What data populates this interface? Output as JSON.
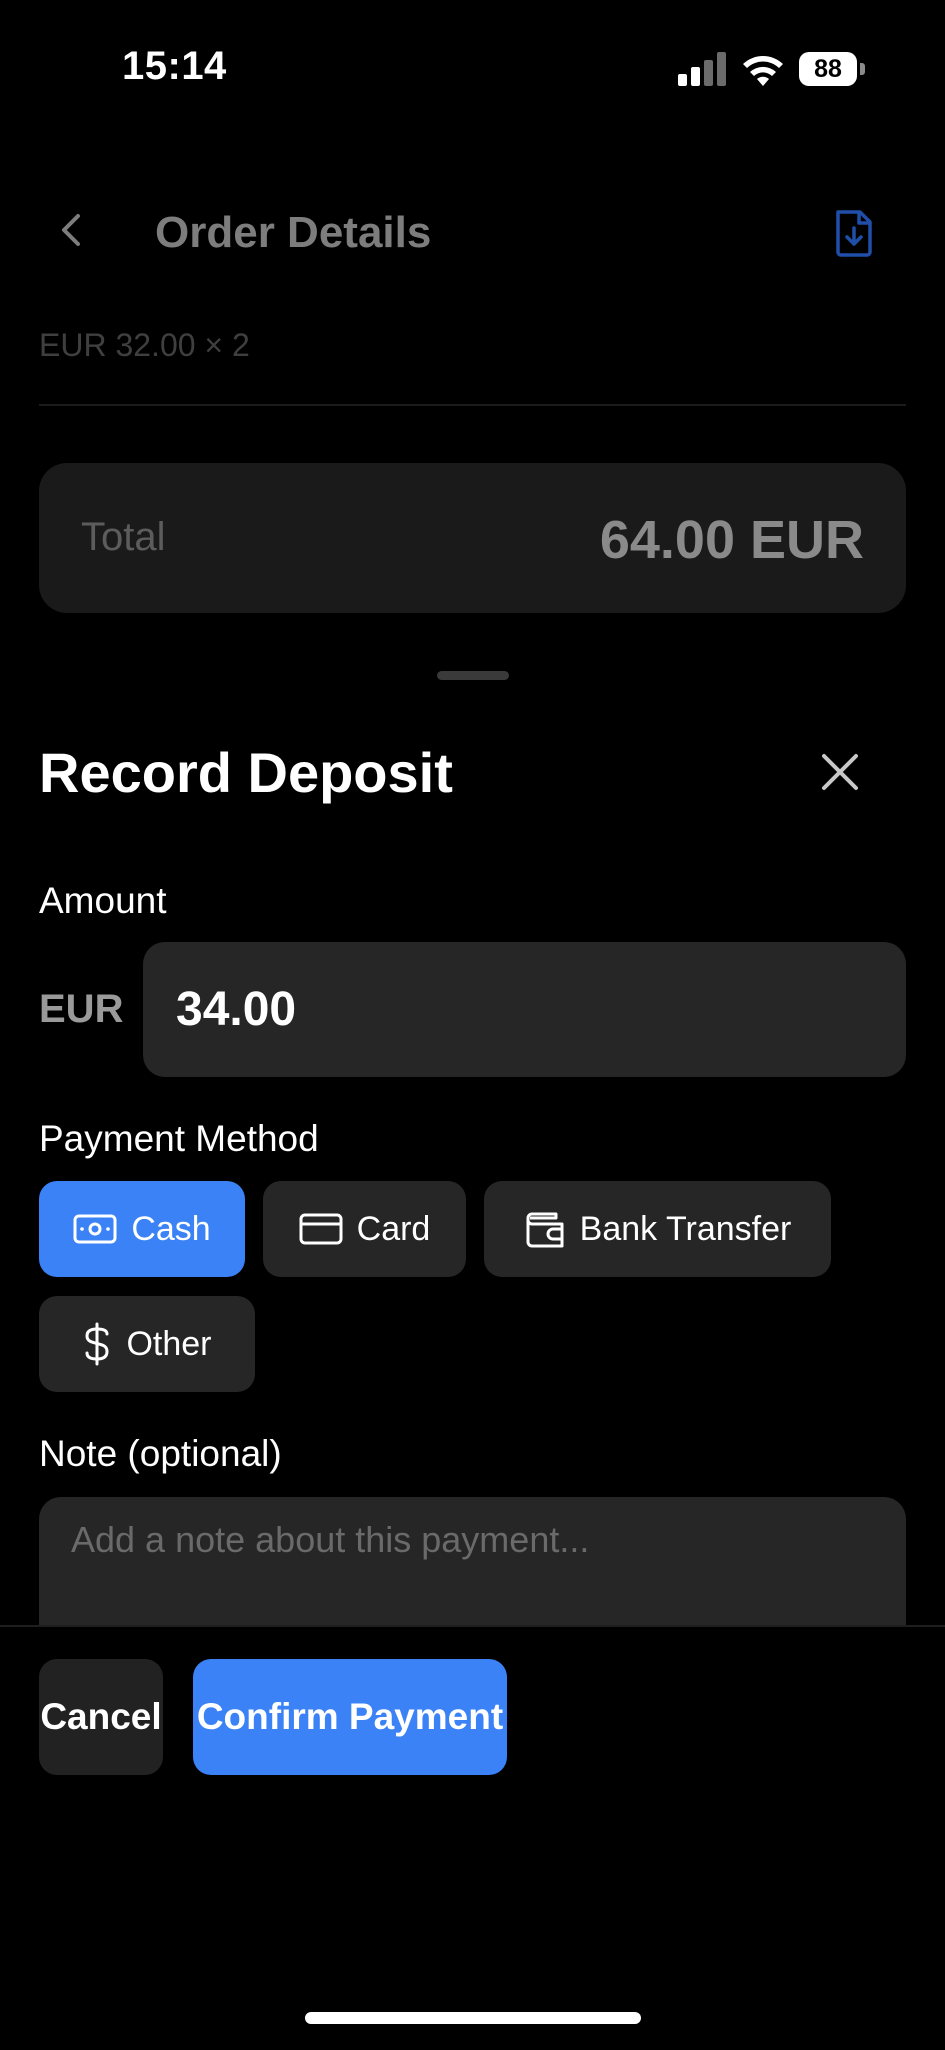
{
  "status_bar": {
    "time": "15:14",
    "battery": "88"
  },
  "header": {
    "title": "Order Details"
  },
  "order": {
    "line_summary": "EUR 32.00 × 2",
    "total_label": "Total",
    "total_value": "64.00 EUR"
  },
  "sheet": {
    "title": "Record Deposit",
    "amount_label": "Amount",
    "currency": "EUR",
    "amount_value": "34.00",
    "payment_method_label": "Payment Method",
    "methods": [
      {
        "label": "Cash",
        "icon": "cash-icon",
        "selected": true
      },
      {
        "label": "Card",
        "icon": "credit-card-icon",
        "selected": false
      },
      {
        "label": "Bank Transfer",
        "icon": "wallet-icon",
        "selected": false
      },
      {
        "label": "Other",
        "icon": "dollar-icon",
        "selected": false
      }
    ],
    "note_label": "Note (optional)",
    "note_placeholder": "Add a note about this payment...",
    "cancel_label": "Cancel",
    "confirm_label": "Confirm Payment"
  },
  "colors": {
    "accent": "#3b82f6",
    "background": "#000000",
    "surface": "#262626"
  }
}
